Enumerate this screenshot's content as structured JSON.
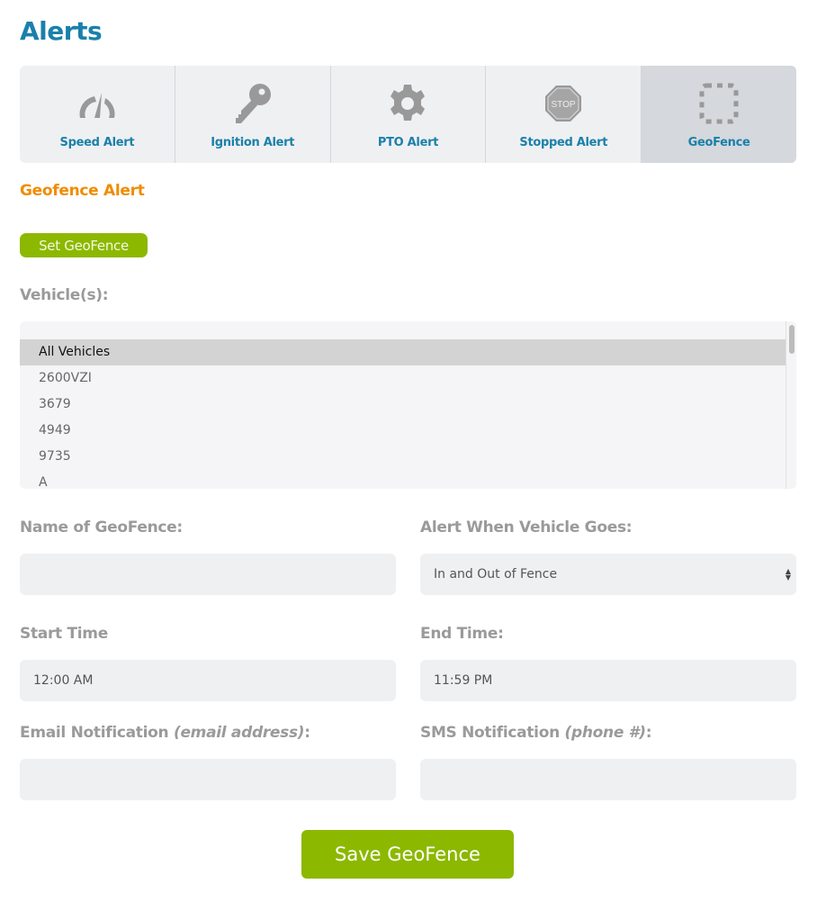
{
  "header": {
    "title": "Alerts"
  },
  "tabs": [
    {
      "label": "Speed Alert",
      "icon": "speedometer-icon"
    },
    {
      "label": "Ignition Alert",
      "icon": "key-icon"
    },
    {
      "label": "PTO Alert",
      "icon": "gear-icon"
    },
    {
      "label": "Stopped Alert",
      "icon": "stop-sign-icon",
      "icon_text": "STOP"
    },
    {
      "label": "GeoFence",
      "icon": "dashed-square-icon",
      "active": true
    }
  ],
  "section_title": "Geofence Alert",
  "set_geofence_label": "Set GeoFence",
  "vehicles": {
    "label": "Vehicle(s):",
    "items": [
      "All Vehicles",
      "2600VZI",
      "3679",
      "4949",
      "9735",
      "A"
    ],
    "selected": "All Vehicles"
  },
  "form": {
    "name_label": "Name of GeoFence:",
    "name_value": "",
    "alert_when_label": "Alert When Vehicle Goes:",
    "alert_when_value": "In and Out of Fence",
    "start_label": "Start Time",
    "start_value": "12:00 AM",
    "end_label": "End Time:",
    "end_value": "11:59 PM",
    "email_label": "Email Notification ",
    "email_hint": "(email address)",
    "email_colon": ":",
    "email_value": "",
    "sms_label": "SMS Notification ",
    "sms_hint": "(phone #)",
    "sms_colon": ":",
    "sms_value": ""
  },
  "save_label": "Save GeoFence",
  "colors": {
    "title": "#1a80aa",
    "accent_orange": "#f08c00",
    "button_green": "#8cb800"
  }
}
